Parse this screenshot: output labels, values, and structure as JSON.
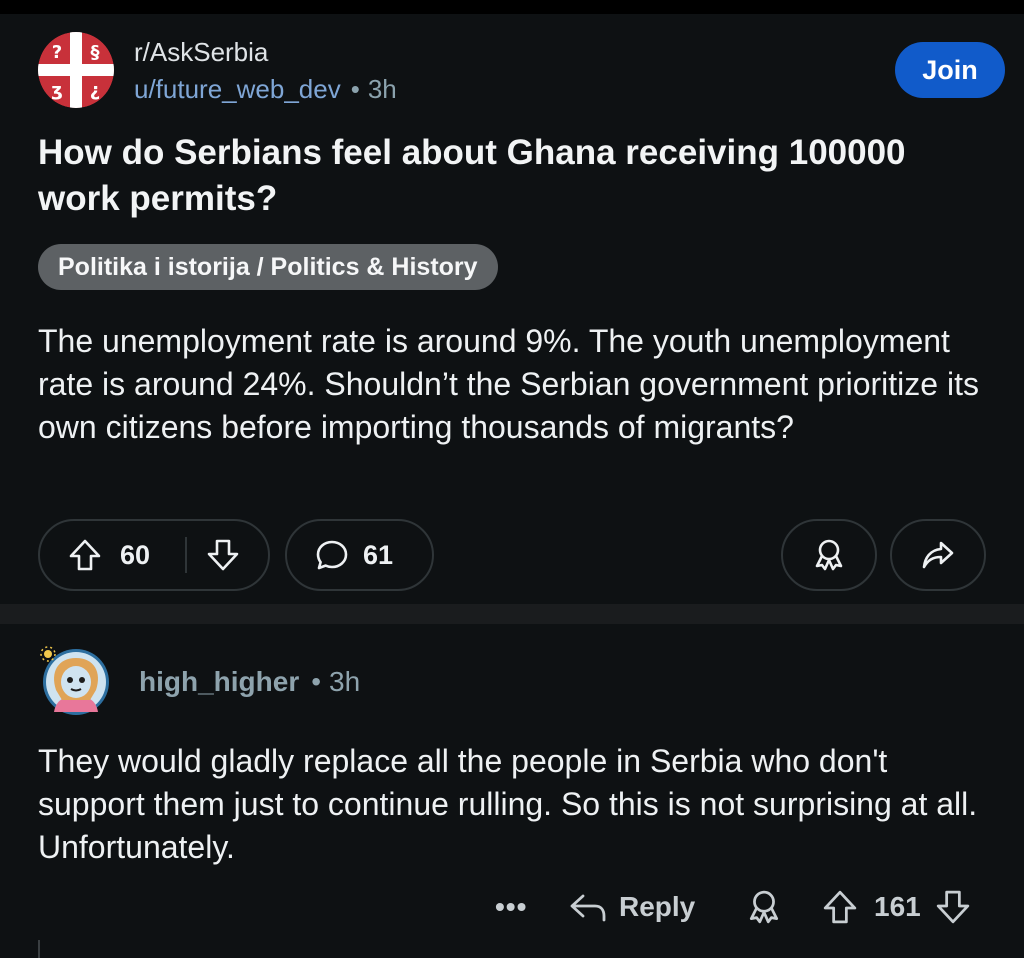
{
  "post": {
    "subreddit": "r/AskSerbia",
    "author": "u/future_web_dev",
    "age": "3h",
    "join_label": "Join",
    "title": "How do Serbians feel about Ghana receiving 100000 work permits?",
    "flair": "Politika i istorija / Politics & History",
    "body": "The unemployment rate is around 9%. The youth unemployment rate is around 24%. Shouldn’t the Serbian government prioritize its own citizens before importing thousands of migrants?",
    "score": "60",
    "comment_count": "61",
    "separator": "•"
  },
  "comment": {
    "author": "high_higher",
    "age": "3h",
    "body": "They would gladly replace all the people in Serbia who don't support them just to continue rulling. So this is not surprising at all. Unfortunately.",
    "more_label": "•••",
    "reply_label": "Reply",
    "score": "161",
    "separator": "•"
  },
  "colors": {
    "background": "#0e1113",
    "join_button": "#115bca",
    "flair": "#5d6164",
    "link_blue": "#7fa6d6"
  },
  "icons": {
    "subreddit_avatar": "serbian-cross-flag-icon",
    "upvote": "arrow-up-outline-icon",
    "downvote": "arrow-down-outline-icon",
    "comment": "speech-bubble-icon",
    "award": "award-ribbon-icon",
    "share": "share-arrow-icon",
    "reply": "reply-arrow-icon",
    "user_avatar": "snoo-avatar-icon"
  }
}
